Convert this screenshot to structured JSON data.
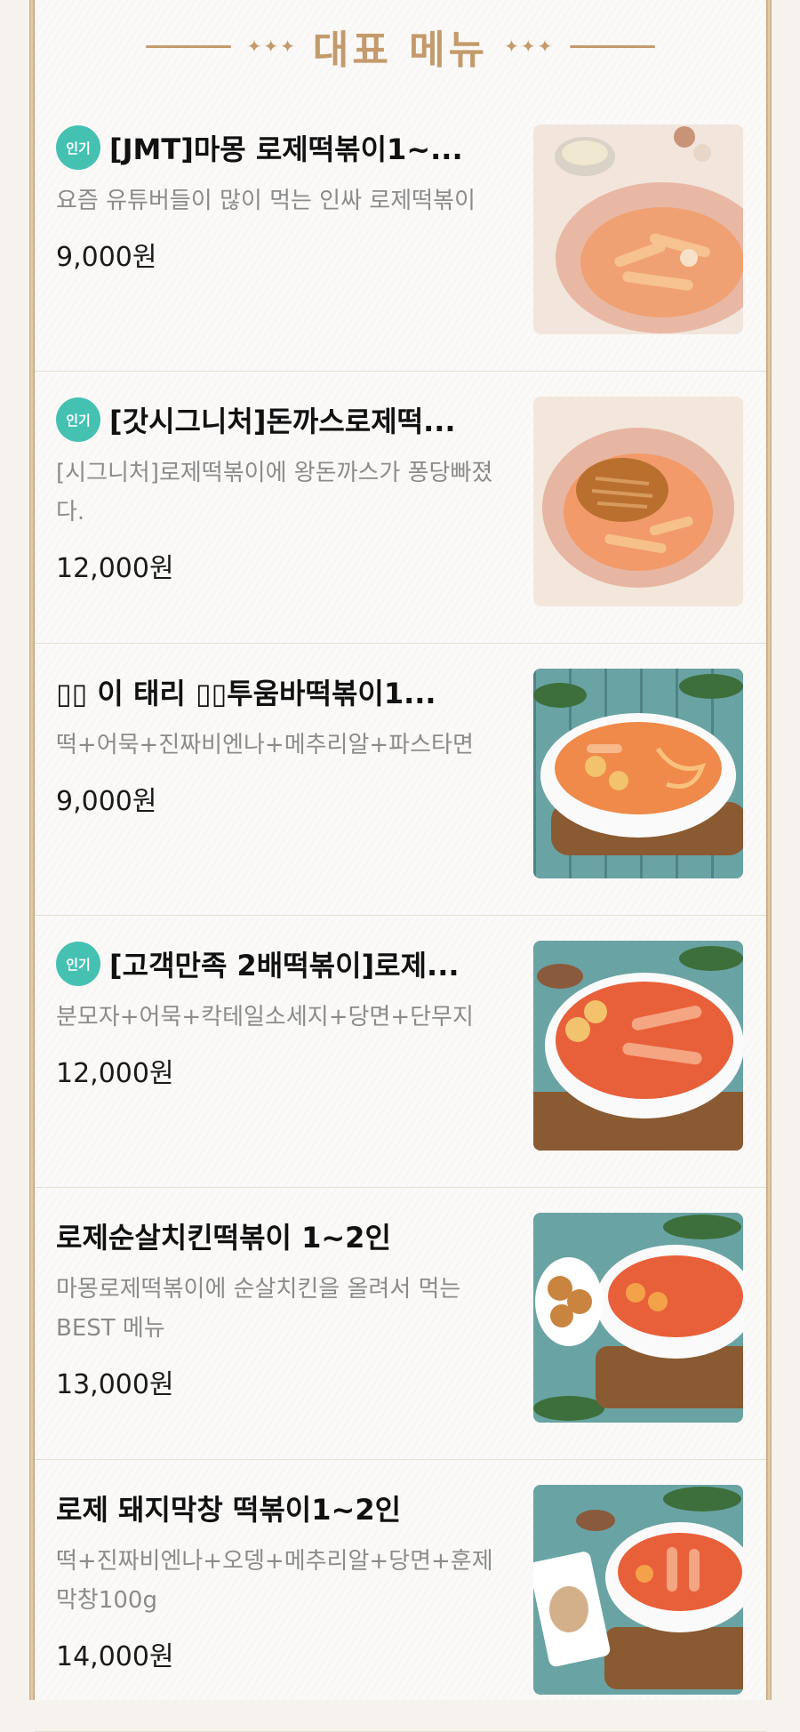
{
  "header": {
    "title": "대표 메뉴",
    "ornament": "✦✦✦"
  },
  "menu": [
    {
      "badge": "인기",
      "name": "[JMT]마몽 로제떡볶이1~...",
      "description": "요즘 유튜버들이 많이 먹는 인싸 로제떡볶이",
      "price": "9,000원",
      "image": "rose-tteokbokki-plate"
    },
    {
      "badge": "인기",
      "name": "[갓시그니처]돈까스로제떡...",
      "description": "[시그니처]로제떡볶이에 왕돈까스가 퐁당빠졌다.",
      "price": "12,000원",
      "image": "pork-cutlet-rose-plate"
    },
    {
      "badge": "",
      "name": "▯▯ 이 태리 ▯▯투움바떡볶이1...",
      "description": "떡+어묵+진짜비엔나+메추리알+파스타면",
      "price": "9,000원",
      "image": "toowoomba-bowl"
    },
    {
      "badge": "인기",
      "name": "[고객만족 2배떡볶이]로제...",
      "description": "분모자+어묵+칵테일소세지+당면+단무지",
      "price": "12,000원",
      "image": "double-tteokbokki-bowl"
    },
    {
      "badge": "",
      "name": "로제순살치킨떡볶이 1~2인",
      "description": "마몽로제떡볶이에 순살치킨을 올려서 먹는 BEST 메뉴",
      "price": "13,000원",
      "image": "chicken-tteokbokki-bowl"
    },
    {
      "badge": "",
      "name": "로제 돼지막창 떡볶이1~2인",
      "description": "떡+진짜비엔나+오뎅+메추리알+당면+훈제막창100g",
      "price": "14,000원",
      "image": "pork-tripe-tteokbokki-bowl"
    }
  ],
  "colors": {
    "accent": "#c49a6c",
    "badge": "#45c1b2"
  }
}
